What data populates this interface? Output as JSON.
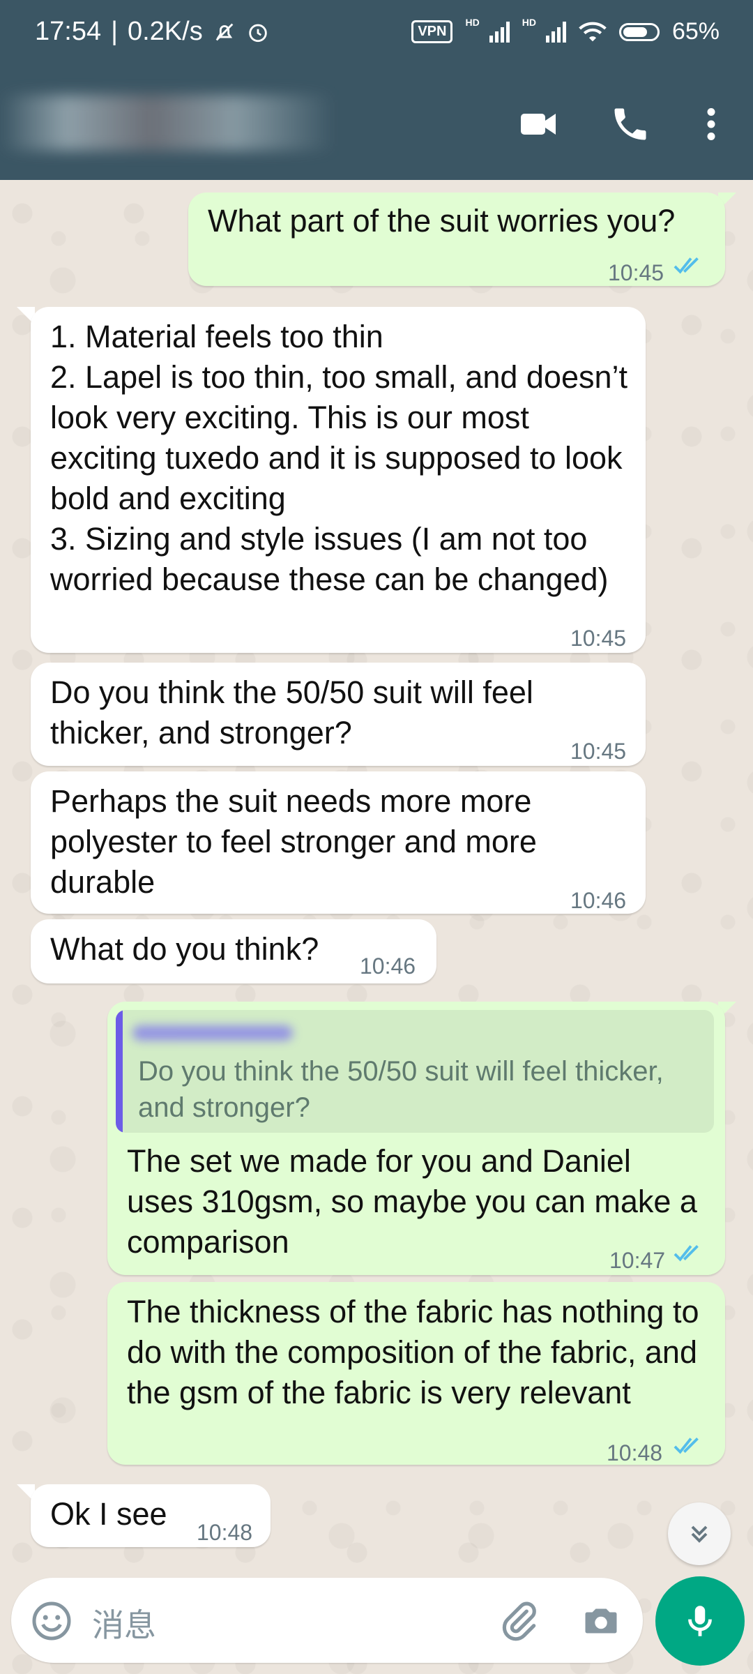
{
  "status_bar": {
    "time": "17:54",
    "net_speed": "0.2K/s",
    "vpn": "VPN",
    "hd1": "HD",
    "hd2": "HD",
    "battery": "65%"
  },
  "header": {
    "video_call_icon": "video-camera-icon",
    "voice_call_icon": "phone-icon",
    "menu_icon": "more-vertical-icon"
  },
  "messages": [
    {
      "side": "out",
      "text": "What part of the suit worries you?",
      "time": "10:45",
      "status": "read"
    },
    {
      "side": "in",
      "text": "1. Material feels too thin\n2. Lapel is too thin, too small, and doesn’t look very exciting. This is our most exciting tuxedo and it is supposed to look bold and exciting\n3. Sizing and style issues (I am not too worried because these can be changed)",
      "time": "10:45"
    },
    {
      "side": "in",
      "text": "Do you think the 50/50 suit will feel thicker, and stronger?",
      "time": "10:45"
    },
    {
      "side": "in",
      "text": "Perhaps the suit needs more more polyester to feel stronger and more durable",
      "time": "10:46"
    },
    {
      "side": "in",
      "text": "What do you think?",
      "time": "10:46"
    },
    {
      "side": "out",
      "quote": "Do you think the 50/50 suit will feel thicker, and stronger?",
      "text": "The set we made for you and Daniel uses 310gsm, so maybe you can make a comparison",
      "time": "10:47",
      "status": "read"
    },
    {
      "side": "out",
      "text": "The thickness of the fabric has nothing to do with the composition of the fabric, and the gsm of the fabric is very relevant",
      "time": "10:48",
      "status": "read"
    },
    {
      "side": "in",
      "text": "Ok I see",
      "time": "10:48"
    }
  ],
  "composer": {
    "placeholder": "消息",
    "emoji_icon": "emoji-icon",
    "attach_icon": "paperclip-icon",
    "camera_icon": "camera-icon",
    "mic_icon": "microphone-icon"
  },
  "colors": {
    "header": "#3b5664",
    "outgoing_bubble": "#e1fdd3",
    "incoming_bubble": "#ffffff",
    "read_ticks": "#53bdeb",
    "accent": "#00a884"
  }
}
